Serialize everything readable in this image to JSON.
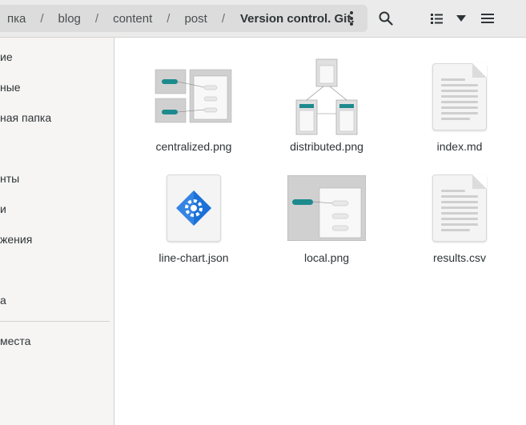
{
  "breadcrumb": {
    "items": [
      "пка",
      "blog",
      "content",
      "post",
      "Version control. Git."
    ],
    "separator": "/"
  },
  "toolbar": {
    "search_icon": "search-icon",
    "view_icon": "list-view-icon",
    "sort_icon": "chevron-down-icon",
    "menu_icon": "hamburger-menu-icon"
  },
  "sidebar": {
    "items": [
      {
        "label": "ие"
      },
      {
        "label": "ные"
      },
      {
        "label": "ная папка"
      },
      {
        "label": "нты"
      },
      {
        "label": "и"
      },
      {
        "label": "жения"
      },
      {
        "label": "а"
      },
      {
        "label": "места"
      }
    ]
  },
  "files": [
    {
      "name": "centralized.png",
      "kind": "image"
    },
    {
      "name": "distributed.png",
      "kind": "image"
    },
    {
      "name": "index.md",
      "kind": "text"
    },
    {
      "name": "line-chart.json",
      "kind": "json"
    },
    {
      "name": "local.png",
      "kind": "image"
    },
    {
      "name": "results.csv",
      "kind": "text"
    }
  ],
  "colors": {
    "accent": "#3584e4",
    "teal": "#1d8a8e",
    "headerbar": "#ebebeb",
    "sidebar": "#f6f5f4"
  }
}
